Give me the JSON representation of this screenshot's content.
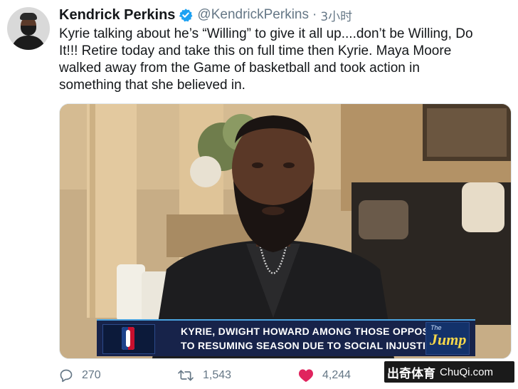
{
  "author": {
    "name": "Kendrick Perkins",
    "handle": "@KendrickPerkins",
    "separator": "·",
    "time": "3小时",
    "verified": true
  },
  "tweet": {
    "lines": [
      "Kyrie talking about he’s “Willing” to give it all up....don’t be Willing, Do",
      "It!!! Retire today and take this on full time then Kyrie. Maya Moore",
      "walked away from the Game of basketball and took action in",
      "something that she believed in."
    ]
  },
  "video": {
    "ticker_line1": "KYRIE, DWIGHT HOWARD AMONG THOSE OPPOSED",
    "ticker_line2": "TO RESUMING SEASON DUE TO SOCIAL INJUSTICE",
    "show_badge_small": "The",
    "show_badge": "Jump",
    "colors": {
      "lower_third": "#17234a",
      "accent": "#4aa3df",
      "jump_text": "#f5d74a"
    }
  },
  "actions": {
    "reply_count": "270",
    "retweet_count": "1,543",
    "like_count": "4,244",
    "icons": [
      "reply-icon",
      "retweet-icon",
      "heart-icon"
    ],
    "colors": {
      "like": "#e0245e",
      "muted": "#657786"
    }
  },
  "watermark": {
    "cn": "出奇体育",
    "en": "ChuQi.com"
  }
}
